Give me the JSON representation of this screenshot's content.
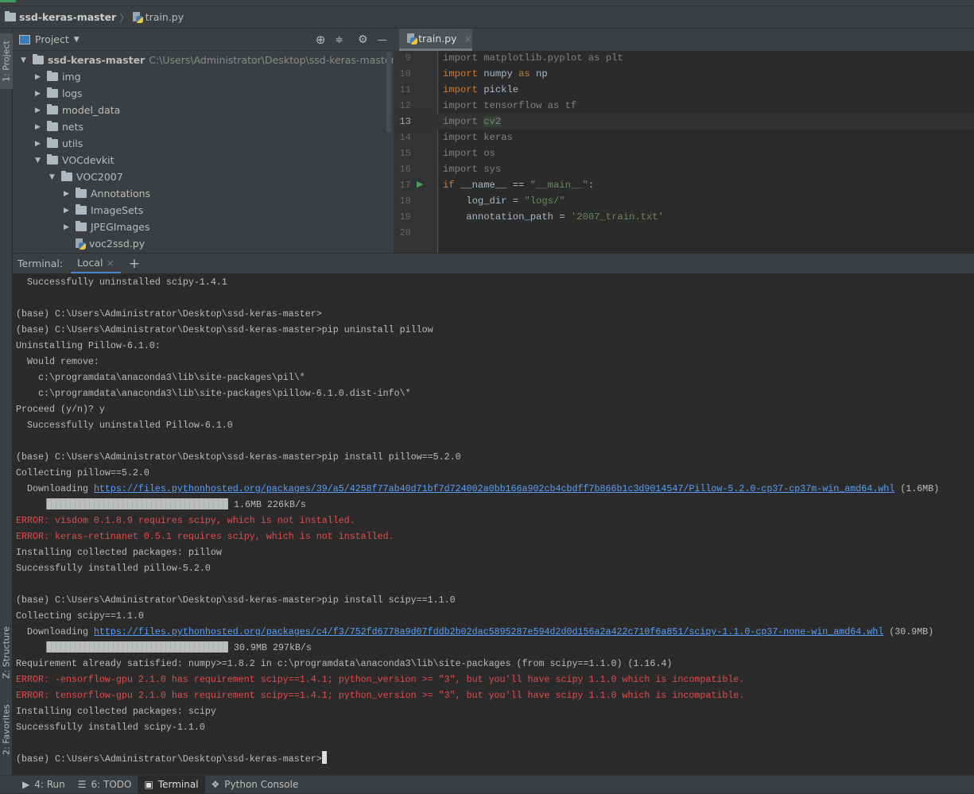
{
  "breadcrumb": {
    "project": "ssd-keras-master",
    "file": "train.py"
  },
  "sidebar_tabs": {
    "project": "1: Project",
    "structure": "Z: Structure",
    "favorites": "2: Favorites"
  },
  "project_panel": {
    "title": "Project",
    "tree": [
      {
        "label": "ssd-keras-master",
        "path": "C:\\Users\\Administrator\\Desktop\\ssd-keras-master",
        "level": 0,
        "type": "folder",
        "expanded": true
      },
      {
        "label": "img",
        "level": 1,
        "type": "folder",
        "expanded": false
      },
      {
        "label": "logs",
        "level": 1,
        "type": "folder",
        "expanded": false
      },
      {
        "label": "model_data",
        "level": 1,
        "type": "folder",
        "expanded": false
      },
      {
        "label": "nets",
        "level": 1,
        "type": "folder",
        "expanded": false
      },
      {
        "label": "utils",
        "level": 1,
        "type": "folder",
        "expanded": false
      },
      {
        "label": "VOCdevkit",
        "level": 1,
        "type": "folder",
        "expanded": true
      },
      {
        "label": "VOC2007",
        "level": 2,
        "type": "folder",
        "expanded": true
      },
      {
        "label": "Annotations",
        "level": 3,
        "type": "folder",
        "expanded": false
      },
      {
        "label": "ImageSets",
        "level": 3,
        "type": "folder",
        "expanded": false
      },
      {
        "label": "JPEGImages",
        "level": 3,
        "type": "folder",
        "expanded": false
      },
      {
        "label": "voc2ssd.py",
        "level": 3,
        "type": "file"
      }
    ]
  },
  "editor": {
    "tab": "train.py",
    "current_line": 13,
    "lines": [
      {
        "n": 9,
        "tokens": [
          [
            "import matplotlib.pyplot as plt",
            "dim"
          ]
        ]
      },
      {
        "n": 10,
        "tokens": [
          [
            "import ",
            "kw"
          ],
          [
            "numpy ",
            "nm"
          ],
          [
            "as ",
            "kw"
          ],
          [
            "np",
            "nm"
          ]
        ]
      },
      {
        "n": 11,
        "tokens": [
          [
            "import ",
            "kw"
          ],
          [
            "pickle",
            "nm"
          ]
        ]
      },
      {
        "n": 12,
        "tokens": [
          [
            "import tensorflow as tf",
            "dim"
          ]
        ]
      },
      {
        "n": 13,
        "tokens": [
          [
            "import ",
            "dim"
          ],
          [
            "cv2",
            "dim hl"
          ]
        ]
      },
      {
        "n": 14,
        "tokens": [
          [
            "import keras",
            "dim"
          ]
        ]
      },
      {
        "n": 15,
        "tokens": [
          [
            "import os",
            "dim"
          ]
        ]
      },
      {
        "n": 16,
        "tokens": [
          [
            "import sys",
            "dim"
          ]
        ]
      },
      {
        "n": 17,
        "tokens": [
          [
            "if ",
            "kw"
          ],
          [
            "__name__ == ",
            "nm"
          ],
          [
            "\"__main__\"",
            "str"
          ],
          [
            ":",
            "nm"
          ]
        ],
        "run": true
      },
      {
        "n": 18,
        "tokens": [
          [
            "    log_dir = ",
            "nm"
          ],
          [
            "\"logs/\"",
            "str"
          ]
        ]
      },
      {
        "n": 19,
        "tokens": [
          [
            "    annotation_path = ",
            "nm"
          ],
          [
            "'2007_train.txt'",
            "str"
          ]
        ]
      },
      {
        "n": 20,
        "tokens": []
      }
    ]
  },
  "terminal": {
    "label": "Terminal:",
    "tab": "Local",
    "lines": [
      {
        "text": "  Successfully uninstalled scipy-1.4.1"
      },
      {
        "text": ""
      },
      {
        "text": "(base) C:\\Users\\Administrator\\Desktop\\ssd-keras-master>"
      },
      {
        "text": "(base) C:\\Users\\Administrator\\Desktop\\ssd-keras-master>pip uninstall pillow"
      },
      {
        "text": "Uninstalling Pillow-6.1.0:"
      },
      {
        "text": "  Would remove:"
      },
      {
        "text": "    c:\\programdata\\anaconda3\\lib\\site-packages\\pil\\*"
      },
      {
        "text": "    c:\\programdata\\anaconda3\\lib\\site-packages\\pillow-6.1.0.dist-info\\*"
      },
      {
        "text": "Proceed (y/n)? y"
      },
      {
        "text": "  Successfully uninstalled Pillow-6.1.0"
      },
      {
        "text": ""
      },
      {
        "text": "(base) C:\\Users\\Administrator\\Desktop\\ssd-keras-master>pip install pillow==5.2.0"
      },
      {
        "text": "Collecting pillow==5.2.0"
      },
      {
        "text": "  Downloading ",
        "url": "https://files.pythonhosted.org/packages/39/a5/4258f77ab40d71bf7d724002a0bb166a902cb4cbdff7b866b1c3d9014547/Pillow-5.2.0-cp37-cp37m-win_amd64.whl",
        "suffix": " (1.6MB)"
      },
      {
        "progress": 1.0,
        "text": " 1.6MB 226kB/s"
      },
      {
        "text": "ERROR: visdom 0.1.8.9 requires scipy, which is not installed.",
        "error": true
      },
      {
        "text": "ERROR: keras-retinanet 0.5.1 requires scipy, which is not installed.",
        "error": true
      },
      {
        "text": "Installing collected packages: pillow"
      },
      {
        "text": "Successfully installed pillow-5.2.0"
      },
      {
        "text": ""
      },
      {
        "text": "(base) C:\\Users\\Administrator\\Desktop\\ssd-keras-master>pip install scipy==1.1.0"
      },
      {
        "text": "Collecting scipy==1.1.0"
      },
      {
        "text": "  Downloading ",
        "url": "https://files.pythonhosted.org/packages/c4/f3/752fd6778a9d07fddb2b02dac5895287e594d2d0d156a2a422c710f6a851/scipy-1.1.0-cp37-none-win_amd64.whl",
        "suffix": " (30.9MB)"
      },
      {
        "progress": 1.0,
        "text": " 30.9MB 297kB/s"
      },
      {
        "text": "Requirement already satisfied: numpy>=1.8.2 in c:\\programdata\\anaconda3\\lib\\site-packages (from scipy==1.1.0) (1.16.4)"
      },
      {
        "text": "ERROR: -ensorflow-gpu 2.1.0 has requirement scipy==1.4.1; python_version >= \"3\", but you'll have scipy 1.1.0 which is incompatible.",
        "error": true
      },
      {
        "text": "ERROR: tensorflow-gpu 2.1.0 has requirement scipy==1.4.1; python_version >= \"3\", but you'll have scipy 1.1.0 which is incompatible.",
        "error": true
      },
      {
        "text": "Installing collected packages: scipy"
      },
      {
        "text": "Successfully installed scipy-1.1.0"
      },
      {
        "text": ""
      },
      {
        "text": "(base) C:\\Users\\Administrator\\Desktop\\ssd-keras-master>",
        "cursor": true
      }
    ]
  },
  "bottom_tabs": [
    {
      "label": "4: Run",
      "icon": "run-icon"
    },
    {
      "label": "6: TODO",
      "icon": "list-icon"
    },
    {
      "label": "Terminal",
      "icon": "terminal-icon",
      "active": true
    },
    {
      "label": "Python Console",
      "icon": "python-icon"
    }
  ],
  "colors": {
    "keyword": "#cc7832",
    "string": "#6a8759",
    "error": "#e24a4a",
    "link": "#589df6"
  }
}
